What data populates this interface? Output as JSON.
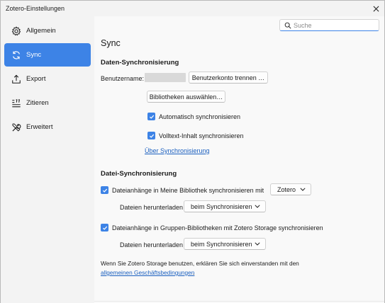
{
  "window": {
    "title": "Zotero-Einstellungen",
    "close_icon": "close-icon"
  },
  "sidebar": {
    "items": [
      {
        "label": "Allgemein",
        "icon": "gear-icon",
        "active": false
      },
      {
        "label": "Sync",
        "icon": "sync-icon",
        "active": true
      },
      {
        "label": "Export",
        "icon": "export-icon",
        "active": false
      },
      {
        "label": "Zitieren",
        "icon": "cite-icon",
        "active": false
      },
      {
        "label": "Erweitert",
        "icon": "tools-icon",
        "active": false
      }
    ]
  },
  "search": {
    "placeholder": "Suche",
    "value": ""
  },
  "main": {
    "title": "Sync",
    "data_sync": {
      "heading": "Daten-Synchronisierung",
      "username_label": "Benutzername:",
      "unlink_button": "Benutzerkonto trennen …",
      "choose_libraries_button": "Bibliotheken auswählen…",
      "auto_sync_label": "Automatisch synchronisieren",
      "auto_sync_checked": true,
      "fulltext_sync_label": "Volltext-Inhalt synchronisieren",
      "fulltext_sync_checked": true,
      "about_sync_link": "Über Synchronisierung"
    },
    "file_sync": {
      "heading": "Datei-Synchronisierung",
      "my_library_label": "Dateianhänge in Meine Bibliothek synchronisieren mit",
      "my_library_checked": true,
      "my_library_service": "Zotero",
      "download_label_1": "Dateien herunterladen",
      "download_mode_1": "beim Synchronisieren",
      "groups_label": "Dateianhänge in Gruppen-Bibliotheken mit Zotero Storage synchronisieren",
      "groups_checked": true,
      "download_label_2": "Dateien herunterladen",
      "download_mode_2": "beim Synchronisieren",
      "terms_text": "Wenn Sie Zotero Storage benutzen, erklären Sie sich einverstanden mit den",
      "terms_link": "allgemeinen Geschäftsbedingungen",
      "terms_end": "."
    }
  },
  "colors": {
    "accent": "#3d83e6",
    "link": "#1a5fbf",
    "sidebar_bg": "#f3f3f3",
    "content_bg": "#f9f9f9"
  }
}
